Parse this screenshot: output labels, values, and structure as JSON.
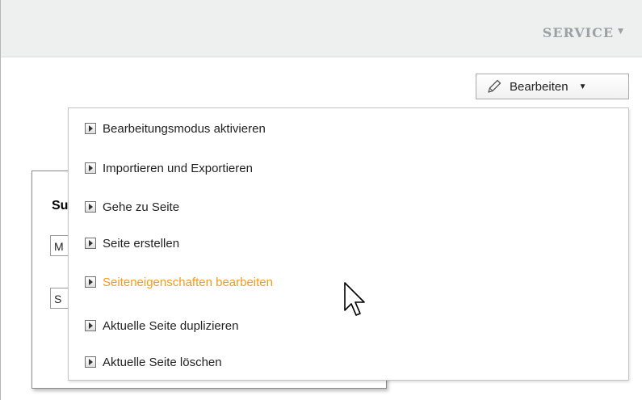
{
  "header": {
    "service_label": "SERVICE",
    "service_caret": "▼"
  },
  "background_card": {
    "title": "Su",
    "field1_value": "M",
    "field2_value": "S"
  },
  "toolbar": {
    "edit_label": "Bearbeiten",
    "edit_caret": "▼",
    "edit_icon": "pencil-icon"
  },
  "dropdown": {
    "icon": "submenu-arrow-icon",
    "items": [
      {
        "label": "Bearbeitungsmodus aktivieren",
        "active": false
      },
      {
        "label": "Importieren und Exportieren",
        "active": false
      },
      {
        "label": "Gehe zu Seite",
        "active": false
      },
      {
        "label": "Seite erstellen",
        "active": false
      },
      {
        "label": "Seiteneigenschaften bearbeiten",
        "active": true
      },
      {
        "label": "Aktuelle Seite duplizieren",
        "active": false
      },
      {
        "label": "Aktuelle Seite löschen",
        "active": false
      }
    ]
  },
  "colors": {
    "active_item": "#f39a1b",
    "header_bg": "#eef0f0",
    "service_text": "#9ba1a5"
  }
}
